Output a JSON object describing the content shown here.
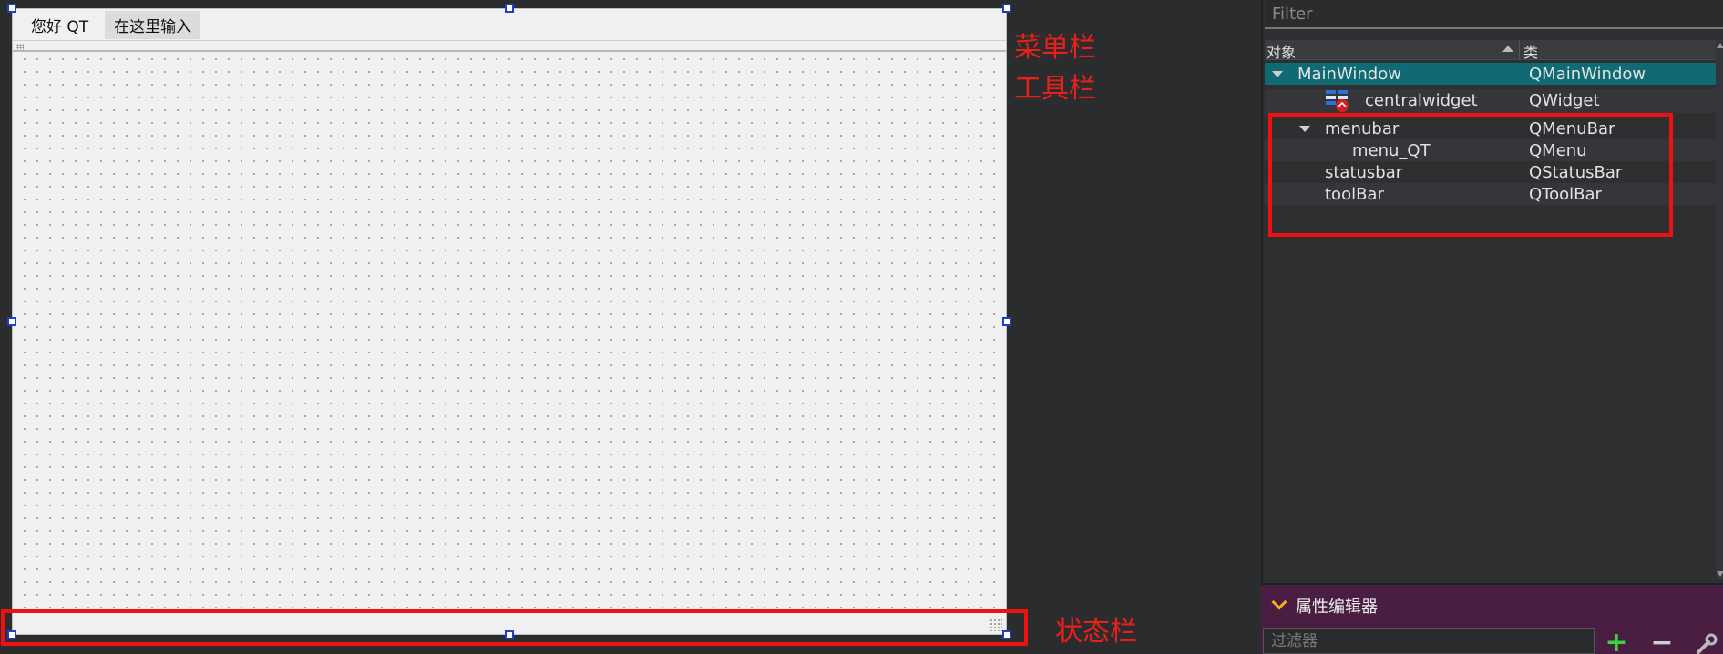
{
  "form": {
    "menubar": {
      "items": [
        {
          "label": "您好 QT"
        },
        {
          "label": "在这里输入"
        }
      ]
    }
  },
  "annotations": {
    "menubar_label": "菜单栏",
    "toolbar_label": "工具栏",
    "statusbar_label": "状态栏",
    "color": "#ee1111"
  },
  "object_inspector": {
    "filter_placeholder": "Filter",
    "columns": {
      "object": "对象",
      "class": "类"
    },
    "rows": [
      {
        "object": "MainWindow",
        "class": "QMainWindow",
        "selected": true,
        "expanded": true
      },
      {
        "object": "centralwidget",
        "class": "QWidget",
        "icon": "widget-icon"
      },
      {
        "object": "menubar",
        "class": "QMenuBar",
        "expanded": true
      },
      {
        "object": "menu_QT",
        "class": "QMenu"
      },
      {
        "object": "statusbar",
        "class": "QStatusBar"
      },
      {
        "object": "toolBar",
        "class": "QToolBar"
      }
    ],
    "selection_color": "#0f6a74"
  },
  "property_editor": {
    "title": "属性编辑器",
    "filter_placeholder": "过滤器",
    "header_color": "#4a1e42"
  }
}
